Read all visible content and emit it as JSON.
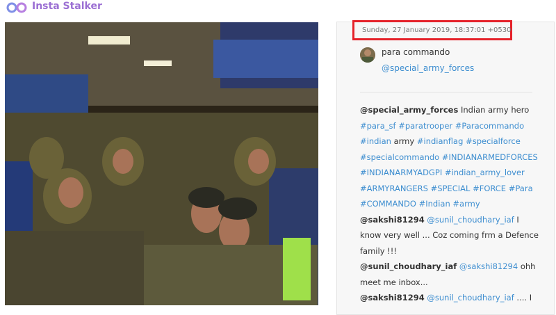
{
  "app": {
    "title": "Insta Stalker",
    "logo_icon": "infinity-link-icon"
  },
  "post": {
    "image_icon": "photo-soldiers-sleeping-in-bus",
    "timestamp": "Sunday, 27 January 2019, 18:37:01 +0530",
    "author": {
      "name": "para commando",
      "handle": "@special_army_forces"
    },
    "comments": [
      {
        "user": "@special_army_forces",
        "parts": [
          {
            "kind": "plain",
            "text": "Indian army hero"
          },
          {
            "kind": "tag",
            "text": "#para_sf"
          },
          {
            "kind": "tag",
            "text": "#paratrooper"
          },
          {
            "kind": "tag",
            "text": "#Paracommando"
          },
          {
            "kind": "tag",
            "text": "#indian"
          },
          {
            "kind": "plain",
            "text": "army"
          },
          {
            "kind": "tag",
            "text": "#indianflag"
          },
          {
            "kind": "tag",
            "text": "#specialforce"
          },
          {
            "kind": "tag",
            "text": "#specialcommando"
          },
          {
            "kind": "tag",
            "text": "#INDIANARMEDFORCES"
          },
          {
            "kind": "tag",
            "text": "#INDIANARMYADGPI"
          },
          {
            "kind": "tag",
            "text": "#indian_army_lover"
          },
          {
            "kind": "tag",
            "text": "#ARMYRANGERS"
          },
          {
            "kind": "tag",
            "text": "#SPECIAL"
          },
          {
            "kind": "tag",
            "text": "#FORCE"
          },
          {
            "kind": "tag",
            "text": "#Para"
          },
          {
            "kind": "tag",
            "text": "#COMMANDO"
          },
          {
            "kind": "tag",
            "text": "#Indian"
          },
          {
            "kind": "tag",
            "text": "#army"
          }
        ]
      },
      {
        "user": "@sakshi81294",
        "parts": [
          {
            "kind": "mention",
            "text": "@sunil_choudhary_iaf"
          },
          {
            "kind": "plain",
            "text": "I know very well ... Coz coming frm a Defence family !!!"
          }
        ]
      },
      {
        "user": "@sunil_choudhary_iaf",
        "parts": [
          {
            "kind": "mention",
            "text": "@sakshi81294"
          },
          {
            "kind": "plain",
            "text": "ohh meet me inbox..."
          }
        ]
      },
      {
        "user": "@sakshi81294",
        "parts": [
          {
            "kind": "mention",
            "text": "@sunil_choudhary_iaf"
          },
          {
            "kind": "plain",
            "text": ".... I"
          }
        ]
      }
    ]
  },
  "colors": {
    "brand": "#9b6fd3",
    "link": "#3e8ed0",
    "highlight_border": "#e5222a"
  }
}
